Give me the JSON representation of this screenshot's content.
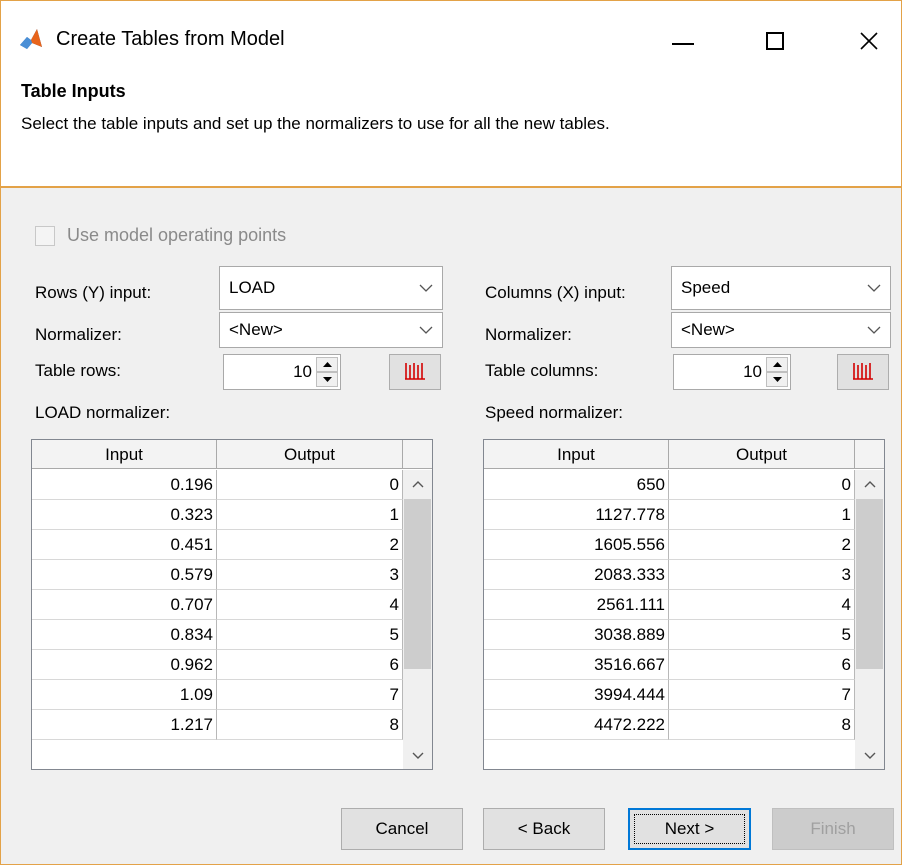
{
  "window": {
    "title": "Create Tables from Model",
    "min_icon": "minimize-icon",
    "max_icon": "maximize-icon",
    "close_icon": "close-icon",
    "close_glyph": "✕"
  },
  "header": {
    "title": "Table Inputs",
    "description": "Select the table inputs and set up the normalizers to use for all the new tables."
  },
  "options": {
    "use_operating_points_label": "Use model operating points",
    "use_operating_points_checked": false,
    "use_operating_points_enabled": false
  },
  "rows_panel": {
    "input_label": "Rows (Y) input:",
    "input_value": "LOAD",
    "normalizer_label": "Normalizer:",
    "normalizer_value": "<New>",
    "count_label": "Table rows:",
    "count_value": "10",
    "normalizer_name_label": "LOAD normalizer:",
    "columns": [
      "Input",
      "Output"
    ],
    "rows": [
      [
        "0.196",
        "0"
      ],
      [
        "0.323",
        "1"
      ],
      [
        "0.451",
        "2"
      ],
      [
        "0.579",
        "3"
      ],
      [
        "0.707",
        "4"
      ],
      [
        "0.834",
        "5"
      ],
      [
        "0.962",
        "6"
      ],
      [
        "1.09",
        "7"
      ],
      [
        "1.217",
        "8"
      ]
    ]
  },
  "columns_panel": {
    "input_label": "Columns (X) input:",
    "input_value": "Speed",
    "normalizer_label": "Normalizer:",
    "normalizer_value": "<New>",
    "count_label": "Table columns:",
    "count_value": "10",
    "normalizer_name_label": "Speed normalizer:",
    "columns": [
      "Input",
      "Output"
    ],
    "rows": [
      [
        "650",
        "0"
      ],
      [
        "1127.778",
        "1"
      ],
      [
        "1605.556",
        "2"
      ],
      [
        "2083.333",
        "3"
      ],
      [
        "2561.111",
        "4"
      ],
      [
        "3038.889",
        "5"
      ],
      [
        "3516.667",
        "6"
      ],
      [
        "3994.444",
        "7"
      ],
      [
        "4472.222",
        "8"
      ]
    ]
  },
  "footer": {
    "cancel": "Cancel",
    "back": "< Back",
    "next": "Next >",
    "finish": "Finish"
  },
  "colors": {
    "window_border": "#e3a248",
    "focus_blue": "#0078d7",
    "bars_icon_red": "#d40000"
  }
}
